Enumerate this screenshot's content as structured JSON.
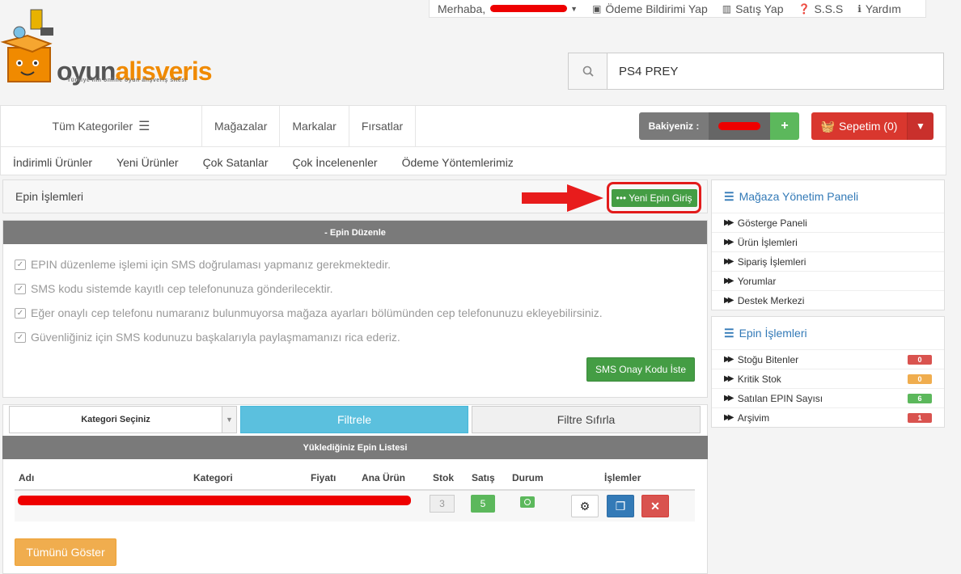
{
  "topbar": {
    "greeting": "Merhaba,",
    "payment_notice": "Ödeme Bildirimi Yap",
    "sell": "Satış Yap",
    "faq": "S.S.S",
    "help": "Yardım"
  },
  "logo": {
    "part1": "oyun",
    "part2": "alisveris",
    "tagline": "Türkiye'nin online oyun alışveriş sitesi"
  },
  "search": {
    "value": "PS4 PREY"
  },
  "nav": {
    "all_categories": "Tüm Kategoriler",
    "links": [
      "Mağazalar",
      "Markalar",
      "Fırsatlar"
    ],
    "secondary": [
      "İndirimli Ürünler",
      "Yeni Ürünler",
      "Çok Satanlar",
      "Çok İncelenenler",
      "Ödeme Yöntemlerimiz"
    ],
    "balance_label": "Bakiyeniz :",
    "balance_plus": "+",
    "cart_label": "Sepetim (0)"
  },
  "epin": {
    "header": "Epin İşlemleri",
    "new_button": "Yeni Epin Giriş",
    "edit_title": "- Epin Düzenle",
    "notes": [
      "EPIN düzenleme işlemi için SMS doğrulaması yapmanız gerekmektedir.",
      "SMS kodu sistemde kayıtlı cep telefonunuza gönderilecektir.",
      "Eğer onaylı cep telefonu numaranız bulunmuyorsa mağaza ayarları bölümünden cep telefonunuzu ekleyebilirsiniz.",
      "Güvenliğiniz için SMS kodunuzu başkalarıyla paylaşmamanızı rica ederiz."
    ],
    "sms_button": "SMS Onay Kodu İste"
  },
  "filter": {
    "category_select": "Kategori Seçiniz",
    "filter_button": "Filtrele",
    "reset_button": "Filtre Sıfırla",
    "list_title": "Yüklediğiniz Epin Listesi"
  },
  "table": {
    "headers": {
      "name": "Adı",
      "category": "Kategori",
      "price": "Fiyatı",
      "main_product": "Ana Ürün",
      "stock": "Stok",
      "sales": "Satış",
      "status": "Durum",
      "actions": "İşlemler"
    },
    "row": {
      "stock": "3",
      "sales": "5"
    }
  },
  "show_all": "Tümünü Göster",
  "sidebar": {
    "store_panel_title": "Mağaza Yönetim Paneli",
    "store_items": [
      "Gösterge Paneli",
      "Ürün İşlemleri",
      "Sipariş İşlemleri",
      "Yorumlar",
      "Destek Merkezi"
    ],
    "epin_panel_title": "Epin İşlemleri",
    "epin_items": [
      {
        "label": "Stoğu Bitenler",
        "count": "0",
        "color": "#d9534f"
      },
      {
        "label": "Kritik Stok",
        "count": "0",
        "color": "#f0ad4e"
      },
      {
        "label": "Satılan EPIN Sayısı",
        "count": "6",
        "color": "#5cb85c"
      },
      {
        "label": "Arşivim",
        "count": "1",
        "color": "#d9534f"
      }
    ]
  }
}
